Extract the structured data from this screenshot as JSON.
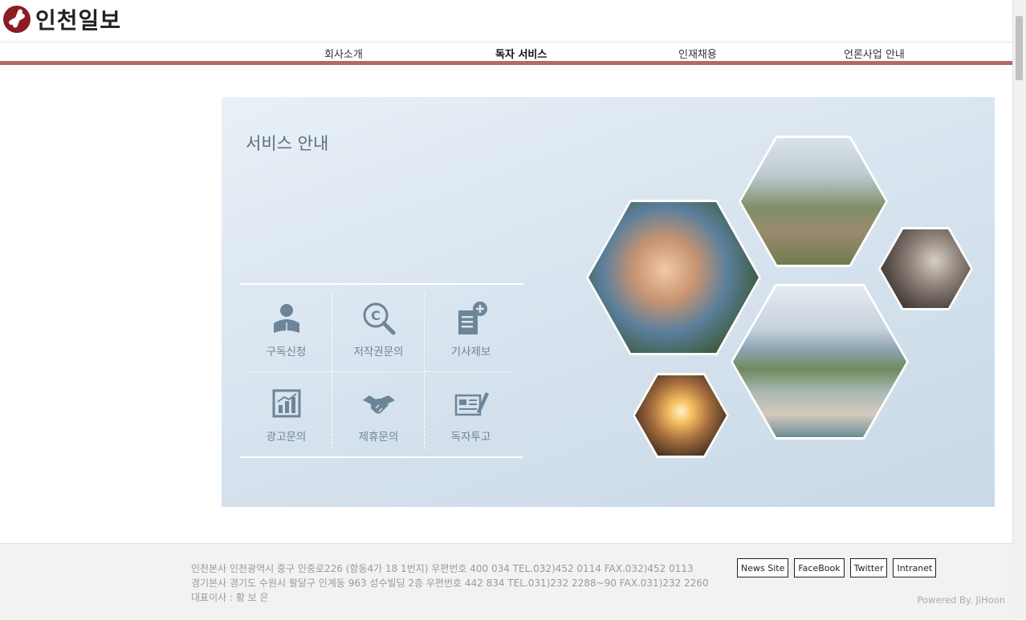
{
  "logo": {
    "text": "인천일보"
  },
  "nav": {
    "items": [
      {
        "label": "회사소개"
      },
      {
        "label": "독자 서비스"
      },
      {
        "label": "인재채용"
      },
      {
        "label": "언론사업 안내"
      }
    ]
  },
  "panel": {
    "title": "서비스 안내",
    "services": [
      {
        "label": "구독신청",
        "icon": "reader-icon"
      },
      {
        "label": "저작권문의",
        "icon": "copyright-search-icon"
      },
      {
        "label": "기사제보",
        "icon": "document-add-icon"
      },
      {
        "label": "광고문의",
        "icon": "bar-chart-icon"
      },
      {
        "label": "제휴문의",
        "icon": "handshake-icon"
      },
      {
        "label": "독자투고",
        "icon": "newspaper-pen-icon"
      }
    ]
  },
  "footer": {
    "address_lines": [
      "인천본사 인천광역시 중구 인중로226 (항동4가 18 1번지) 우편번호 400 034 TEL.032)452 0114 FAX.032)452 0113",
      "경기본사 경기도 수원시 팔달구 인계동 963 성수빌딩 2층 우편번호 442 834 TEL.031)232 2288~90 FAX.031)232 2260",
      "대표이사 : 황 보 은"
    ],
    "links": [
      {
        "label": "News Site"
      },
      {
        "label": "FaceBook"
      },
      {
        "label": "Twitter"
      },
      {
        "label": "Intranet"
      }
    ],
    "powered_by": "Powered By. JiHoon"
  },
  "colors": {
    "accent_bar": "#b06b64",
    "logo_red": "#8a1d22",
    "icon_blue": "#6d8599"
  }
}
